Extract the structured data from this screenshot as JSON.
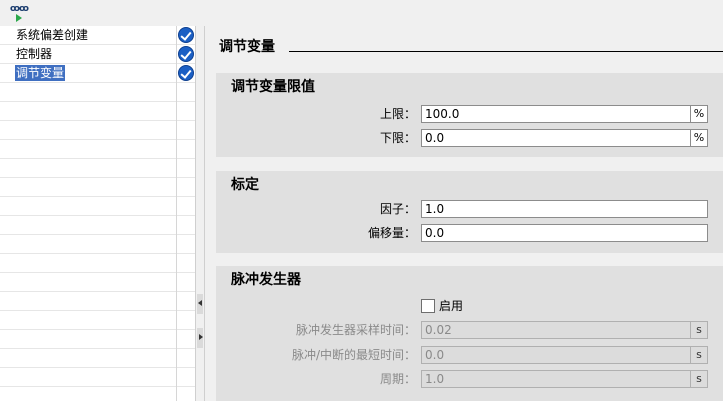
{
  "toolbar": {
    "icon": "glasses-play-icon"
  },
  "nav": {
    "items": [
      {
        "label": "系统偏差创建",
        "checked": true
      },
      {
        "label": "控制器",
        "checked": true
      },
      {
        "label": "调节变量",
        "checked": true,
        "selected": true
      }
    ]
  },
  "main": {
    "title": "调节变量",
    "limits": {
      "title": "调节变量限值",
      "upper_label": "上限：",
      "upper_value": "100.0",
      "upper_unit": "%",
      "lower_label": "下限：",
      "lower_value": "0.0",
      "lower_unit": "%"
    },
    "scaling": {
      "title": "标定",
      "factor_label": "因子：",
      "factor_value": "1.0",
      "offset_label": "偏移量：",
      "offset_value": "0.0"
    },
    "pulse": {
      "title": "脉冲发生器",
      "enable_label": "启用",
      "enable_checked": false,
      "sample_label": "脉冲发生器采样时间：",
      "sample_value": "0.02",
      "sample_unit": "s",
      "min_label": "脉冲/中断的最短时间：",
      "min_value": "0.0",
      "min_unit": "s",
      "period_label": "周期：",
      "period_value": "1.0",
      "period_unit": "s"
    }
  },
  "colors": {
    "check": "#1b5fc4",
    "selected_bg": "#3f6fc1",
    "group_bg": "#e0e0e0"
  }
}
